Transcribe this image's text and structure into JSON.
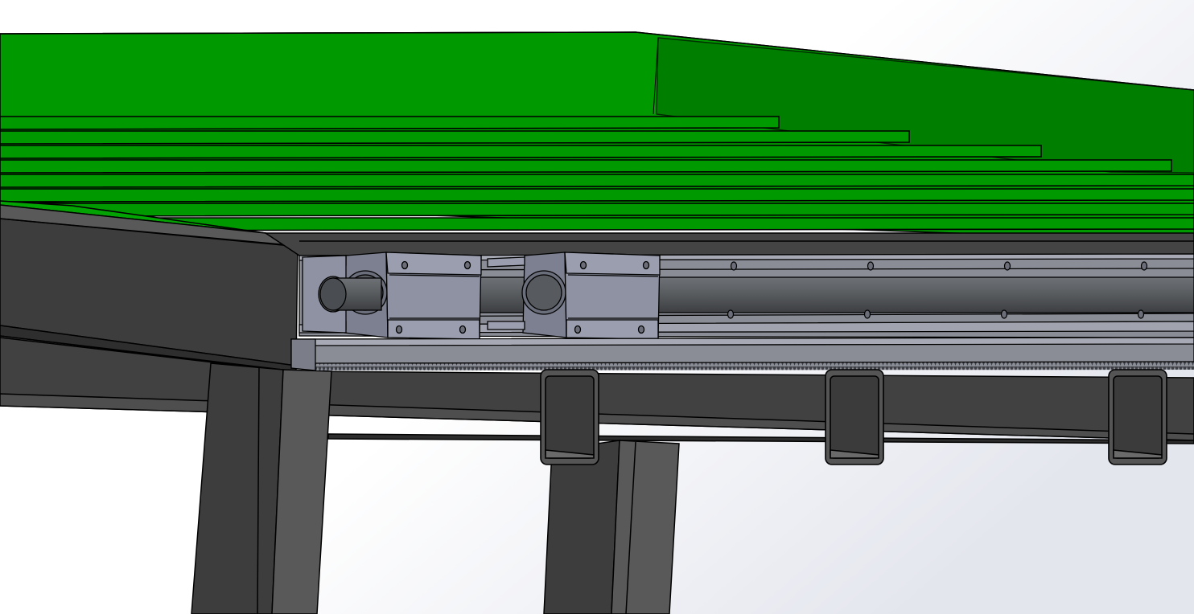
{
  "viewport": {
    "background_top": "#e4e6ee",
    "background_bottom": "#ffffff"
  },
  "colors": {
    "table_top": "#009a00",
    "table_top_shade": "#007e00",
    "table_top_back": "#028d02",
    "frame_dark": "#3d3d3d",
    "frame_mid": "#4a4a4a",
    "frame_light": "#595959",
    "rail_steel": "#8a8d96",
    "rail_highlight": "#a7aab4",
    "bearing_block": "#7c8090",
    "bearing_face": "#8e92a2",
    "shaft": "#5a5d60",
    "outline": "#000000"
  },
  "parts": {
    "slats": 8,
    "bearing_blocks": 2,
    "cross_tubes": 3,
    "legs": 2,
    "rail_mount_holes": 4
  }
}
